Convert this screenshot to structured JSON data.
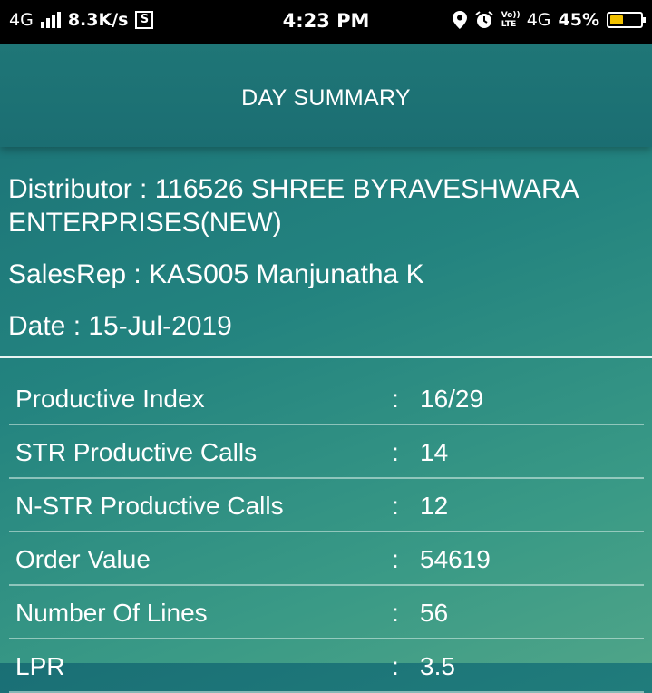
{
  "status_bar": {
    "network": "4G",
    "speed": "8.3K/s",
    "s_icon": "S",
    "time": "4:23 PM",
    "volte": "Vo)) LTE",
    "network2": "4G",
    "battery_percent": "45%",
    "battery_level": 0.45,
    "icons": [
      "signal-bars-icon",
      "location-pin-icon",
      "alarm-clock-icon",
      "battery-icon"
    ]
  },
  "header": {
    "title": "DAY SUMMARY"
  },
  "info": {
    "distributor": "Distributor : 116526 SHREE BYRAVESHWARA ENTERPRISES(NEW)",
    "salesrep": "SalesRep : KAS005 Manjunatha K",
    "date": "Date : 15-Jul-2019"
  },
  "summary": [
    {
      "label": "Productive Index",
      "value": "16/29"
    },
    {
      "label": "STR Productive Calls",
      "value": "14"
    },
    {
      "label": "N-STR Productive Calls",
      "value": "12"
    },
    {
      "label": "Order Value",
      "value": "54619"
    },
    {
      "label": "Number Of Lines",
      "value": "56"
    },
    {
      "label": "LPR",
      "value": "3.5"
    }
  ],
  "separator": ":",
  "colors": {
    "background": "#23837f",
    "header": "#1f7677",
    "battery_fill": "#f2c200"
  }
}
